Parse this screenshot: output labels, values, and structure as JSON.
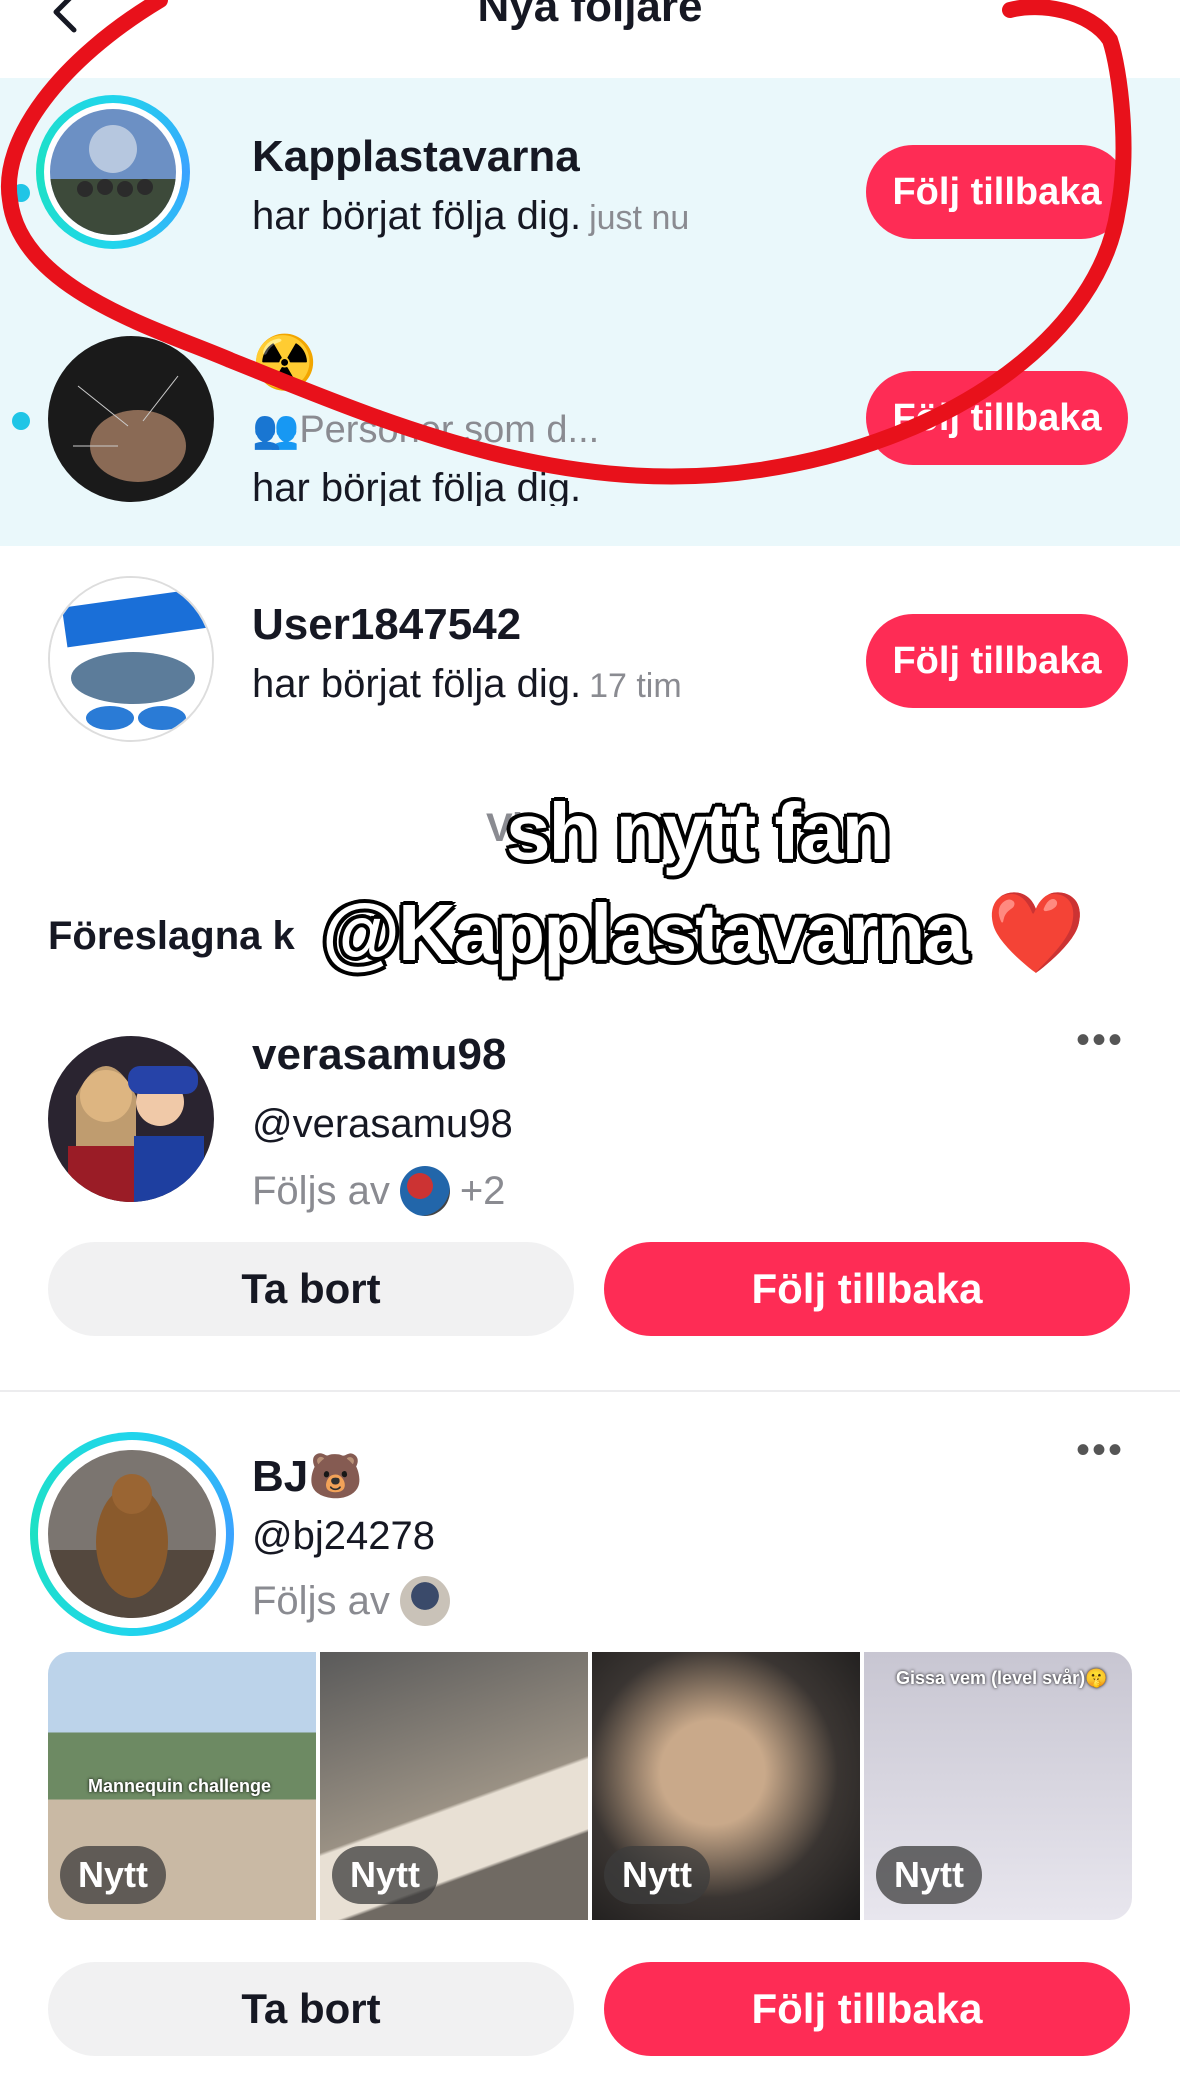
{
  "header": {
    "title": "Nya följare"
  },
  "new_followers": [
    {
      "name": "Kapplastavarna",
      "action": "har börjat följa dig.",
      "time": "just nu",
      "button": "Följ tillbaka"
    },
    {
      "name_emoji": "☢️",
      "meta": "Personer som d...",
      "action_partial": "har börjat följa dig.",
      "button": "Följ tillbaka"
    },
    {
      "name": "User1847542",
      "action": "har börjat följa dig.",
      "time": "17 tim",
      "button": "Följ tillbaka"
    }
  ],
  "hidden_text": "Vi",
  "suggested": {
    "title": "Föreslagna k",
    "accounts": [
      {
        "name": "verasamu98",
        "handle": "@verasamu98",
        "followed_by": "Följs av",
        "extra": "+2",
        "remove": "Ta bort",
        "follow": "Följ tillbaka"
      },
      {
        "name": "BJ🐻",
        "handle": "@bj24278",
        "followed_by": "Följs av",
        "remove": "Ta bort",
        "follow": "Följ tillbaka",
        "thumbs": [
          {
            "badge": "Nytt",
            "caption": "Mannequin challenge"
          },
          {
            "badge": "Nytt"
          },
          {
            "badge": "Nytt"
          },
          {
            "badge": "Nytt",
            "caption": "Gissa vem (level svår)🤫"
          }
        ]
      }
    ]
  },
  "overlay": {
    "line1": "sh nytt fan",
    "line2": "@Kapplastavarna",
    "heart": "❤️"
  },
  "colors": {
    "primary": "#fe2c55",
    "highlight_bg": "#eaf8fb",
    "dot": "#20c5e6",
    "marker": "#e8111b"
  }
}
